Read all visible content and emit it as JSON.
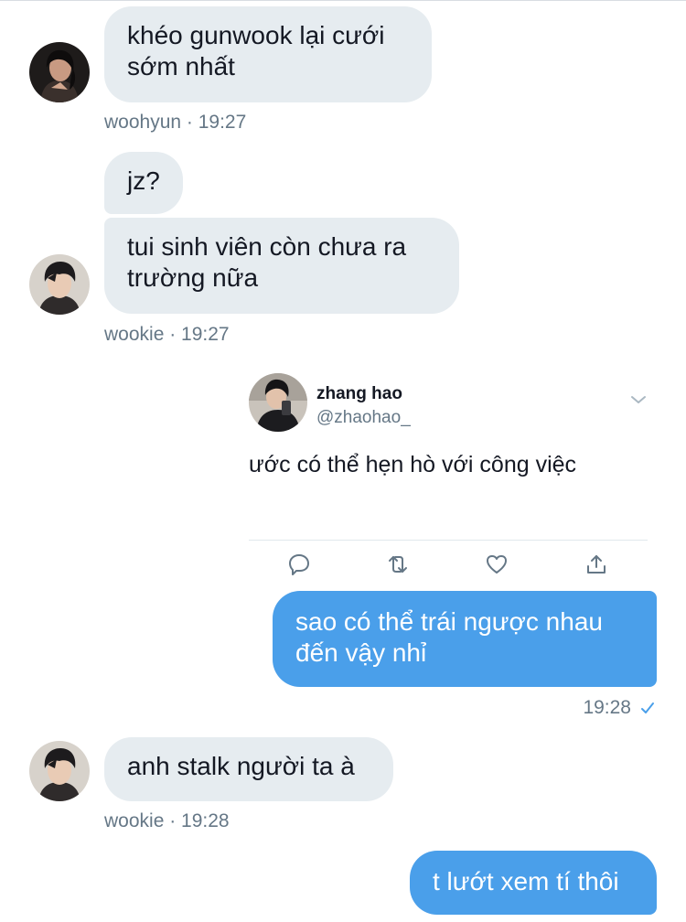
{
  "messages": [
    {
      "text": "khéo gunwook lại cưới sớm nhất",
      "meta": "woohyun · 19:27"
    },
    {
      "text": "jz?"
    },
    {
      "text": "tui sinh viên còn chưa ra trường nữa",
      "meta": "wookie · 19:27"
    },
    {
      "text": "sao có thể trái ngược nhau đến vậy nhỉ",
      "time": "19:28"
    },
    {
      "text": "anh stalk người ta à",
      "meta": "wookie · 19:28"
    },
    {
      "text": "t lướt xem tí thôi"
    }
  ],
  "tweet": {
    "name": "zhang hao",
    "handle": "@zhaohao_",
    "text": "ước có thể hẹn hò với công việc"
  },
  "icons": {
    "read_receipt": "checkmark-icon",
    "tweet_menu": "chevron-down-icon",
    "tweet_actions": [
      "reply-icon",
      "retweet-icon",
      "like-icon",
      "share-icon"
    ]
  },
  "colors": {
    "outgoing_bubble": "#4a9fea",
    "incoming_bubble": "#e6ecf0",
    "meta_text": "#657786"
  }
}
